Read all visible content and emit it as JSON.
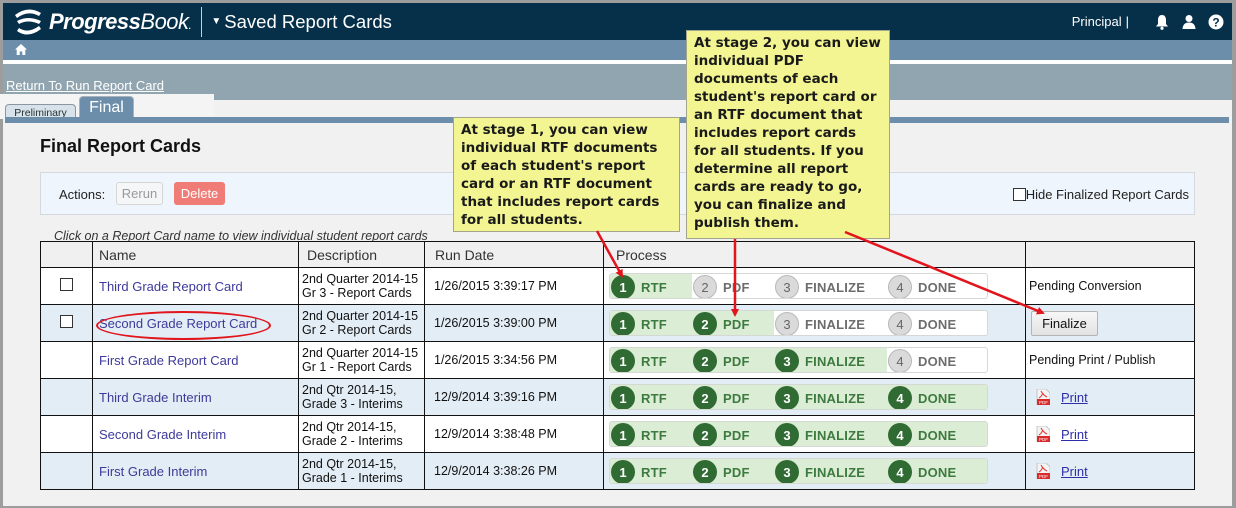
{
  "header": {
    "logo_bold": "Progress",
    "logo_rest": "Book",
    "logo_suffix": ".",
    "app_title": "Saved Report Cards",
    "role": "Principal",
    "role_separator": "|",
    "icons": [
      "bell-icon",
      "user-icon",
      "help-icon"
    ]
  },
  "breadcrumb": {
    "home_icon": "home-icon",
    "return_link": "Return To Run Report Card"
  },
  "tabs": [
    {
      "label": "Preliminary",
      "active": false
    },
    {
      "label": "Final",
      "active": true
    }
  ],
  "page": {
    "title": "Final Report Cards",
    "actions_label": "Actions:",
    "rerun_label": "Rerun",
    "delete_label": "Delete",
    "hide_finalized_label": "Hide Finalized Report Cards",
    "hide_finalized_checked": false,
    "hint": "Click on a Report Card name to view individual student report cards"
  },
  "table": {
    "headers": [
      "",
      "Name",
      "Description",
      "Run Date",
      "Process",
      ""
    ],
    "step_labels": [
      "RTF",
      "PDF",
      "FINALIZE",
      "DONE"
    ],
    "rows": [
      {
        "checkbox": true,
        "name": "Third Grade Report Card",
        "desc1": "2nd Quarter 2014-15",
        "desc2": "Gr 3 - Report Cards",
        "run_date": "1/26/2015  3:39:17 PM",
        "completed_steps": 1,
        "status_type": "text",
        "status": "Pending Conversion"
      },
      {
        "checkbox": true,
        "name": "Second Grade Report Card",
        "desc1": "2nd Quarter 2014-15",
        "desc2": "Gr 2 - Report Cards",
        "run_date": "1/26/2015  3:39:00 PM",
        "completed_steps": 2,
        "status_type": "button",
        "status": "Finalize"
      },
      {
        "checkbox": false,
        "name": "First Grade Report Card",
        "desc1": "2nd Quarter 2014-15",
        "desc2": "Gr 1 - Report Cards",
        "run_date": "1/26/2015  3:34:56 PM",
        "completed_steps": 3,
        "status_type": "text",
        "status": "Pending Print / Publish"
      },
      {
        "checkbox": false,
        "name": "Third Grade Interim",
        "desc1": "2nd Qtr 2014-15,",
        "desc2": "Grade 3 - Interims",
        "run_date": "12/9/2014  3:39:16 PM",
        "completed_steps": 4,
        "status_type": "print",
        "status": "Print"
      },
      {
        "checkbox": false,
        "name": "Second Grade Interim",
        "desc1": "2nd Qtr 2014-15,",
        "desc2": "Grade 2 - Interims",
        "run_date": "12/9/2014  3:38:48 PM",
        "completed_steps": 4,
        "status_type": "print",
        "status": "Print"
      },
      {
        "checkbox": false,
        "name": "First Grade Interim",
        "desc1": "2nd Qtr 2014-15,",
        "desc2": "Grade 1 - Interims",
        "run_date": "12/9/2014  3:38:26 PM",
        "completed_steps": 4,
        "status_type": "print",
        "status": "Print"
      }
    ]
  },
  "callouts": {
    "stage1": "At stage 1, you can view individual RTF documents of each student's report card or an RTF document that includes report cards for all students.",
    "stage2": "At stage 2, you can view individual PDF documents of each student's report card or an RTF document that includes report cards for all students. If you determine all report cards are ready to go, you can finalize and publish them."
  },
  "colors": {
    "topbar": "#06304a",
    "accent_bar": "#6c8eab",
    "step_done": "#2f6b32",
    "step_fill": "#dcedd5",
    "delete_button": "#ef7c76",
    "callout_bg": "#f2f591",
    "annotation_red": "#e2141c"
  }
}
